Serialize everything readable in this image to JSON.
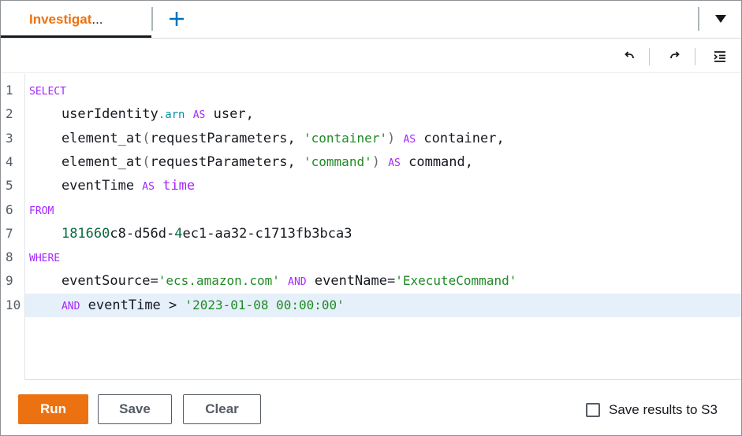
{
  "tabs": {
    "active_label": "Investigat",
    "active_ellipsis": "...",
    "add_icon": "plus-icon",
    "menu_icon": "caret-down-icon"
  },
  "toolbar": {
    "undo_icon": "undo-icon",
    "redo_icon": "redo-icon",
    "format_icon": "indent-icon"
  },
  "editor": {
    "active_line": 10,
    "lines": [
      {
        "n": "1",
        "tokens": [
          {
            "t": "SELECT",
            "c": "kw"
          }
        ]
      },
      {
        "n": "2",
        "tokens": [
          {
            "t": "    userIdentity",
            "c": "id"
          },
          {
            "t": ".arn",
            "c": "prop"
          },
          {
            "t": " ",
            "c": "id"
          },
          {
            "t": "AS",
            "c": "kw"
          },
          {
            "t": " user,",
            "c": "id"
          }
        ]
      },
      {
        "n": "3",
        "tokens": [
          {
            "t": "    element_at",
            "c": "id"
          },
          {
            "t": "(",
            "c": "paren"
          },
          {
            "t": "requestParameters, ",
            "c": "id"
          },
          {
            "t": "'container'",
            "c": "str"
          },
          {
            "t": ")",
            "c": "paren"
          },
          {
            "t": " ",
            "c": "id"
          },
          {
            "t": "AS",
            "c": "kw"
          },
          {
            "t": " container,",
            "c": "id"
          }
        ]
      },
      {
        "n": "4",
        "tokens": [
          {
            "t": "    element_at",
            "c": "id"
          },
          {
            "t": "(",
            "c": "paren"
          },
          {
            "t": "requestParameters, ",
            "c": "id"
          },
          {
            "t": "'command'",
            "c": "str"
          },
          {
            "t": ")",
            "c": "paren"
          },
          {
            "t": " ",
            "c": "id"
          },
          {
            "t": "AS",
            "c": "kw"
          },
          {
            "t": " command,",
            "c": "id"
          }
        ]
      },
      {
        "n": "5",
        "tokens": [
          {
            "t": "    eventTime ",
            "c": "id"
          },
          {
            "t": "AS",
            "c": "kw"
          },
          {
            "t": " ",
            "c": "id"
          },
          {
            "t": "time",
            "c": "kw-big"
          }
        ]
      },
      {
        "n": "6",
        "tokens": [
          {
            "t": "FROM",
            "c": "kw"
          }
        ]
      },
      {
        "n": "7",
        "tokens": [
          {
            "t": "    ",
            "c": "id"
          },
          {
            "t": "181660",
            "c": "num"
          },
          {
            "t": "c8-d56d-",
            "c": "id"
          },
          {
            "t": "4",
            "c": "num"
          },
          {
            "t": "ec1-aa32-c1713fb3bca3",
            "c": "id"
          }
        ]
      },
      {
        "n": "8",
        "tokens": [
          {
            "t": "WHERE",
            "c": "kw"
          }
        ]
      },
      {
        "n": "9",
        "tokens": [
          {
            "t": "    eventSource=",
            "c": "id"
          },
          {
            "t": "'ecs.amazon.com'",
            "c": "str"
          },
          {
            "t": " ",
            "c": "id"
          },
          {
            "t": "AND",
            "c": "kw"
          },
          {
            "t": " eventName=",
            "c": "id"
          },
          {
            "t": "'ExecuteCommand'",
            "c": "str"
          }
        ]
      },
      {
        "n": "10",
        "tokens": [
          {
            "t": "    ",
            "c": "id"
          },
          {
            "t": "AND",
            "c": "kw"
          },
          {
            "t": " eventTime > ",
            "c": "id"
          },
          {
            "t": "'2023-01-08 00:00:00'",
            "c": "str"
          }
        ]
      }
    ]
  },
  "footer": {
    "run_label": "Run",
    "save_label": "Save",
    "clear_label": "Clear",
    "save_s3_label": "Save results to S3",
    "save_s3_checked": false
  },
  "colors": {
    "accent": "#ec7211",
    "keyword": "#a626ff",
    "string": "#1f8a24",
    "active_line_bg": "#e6f0fa"
  }
}
